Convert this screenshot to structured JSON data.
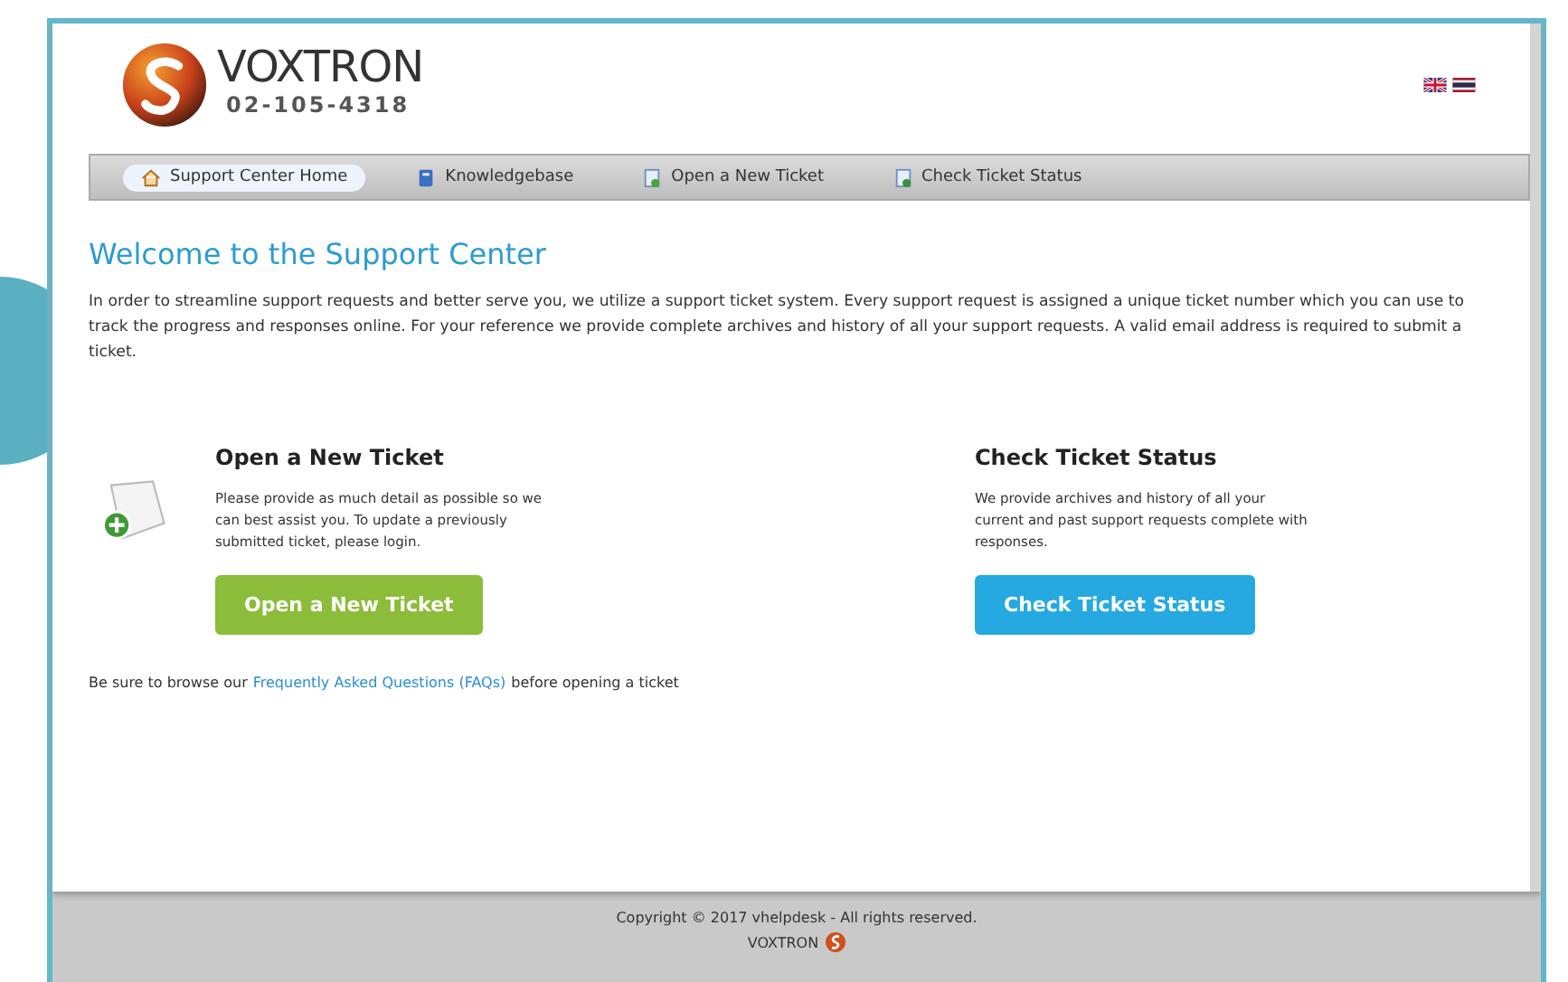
{
  "header": {
    "brand": "VOXTRON",
    "phone": "02-105-4318"
  },
  "nav": [
    {
      "label": "Support Center Home",
      "selected": true,
      "kind": "home"
    },
    {
      "label": "Knowledgebase",
      "selected": false,
      "kind": "book"
    },
    {
      "label": "Open a New Ticket",
      "selected": false,
      "kind": "new"
    },
    {
      "label": "Check Ticket Status",
      "selected": false,
      "kind": "status"
    }
  ],
  "welcome": {
    "title": "Welcome to the Support Center",
    "text": "In order to streamline support requests and better serve you, we utilize a support ticket system. Every support request is assigned a unique ticket number which you can use to track the progress and responses online. For your reference we provide complete archives and history of all your support requests. A valid email address is required to submit a ticket."
  },
  "cards": [
    {
      "title": "Open a New Ticket",
      "text": "Please provide as much detail as possible so we can best assist you. To update a previously submitted ticket, please login.",
      "button": "Open a New Ticket",
      "kind": "green"
    },
    {
      "title": "Check Ticket Status",
      "text": "We provide archives and history of all your current and past support requests complete with responses.",
      "button": "Check Ticket Status",
      "kind": "blue"
    }
  ],
  "faq": {
    "before": "Be sure to browse our",
    "link": "Frequently Asked Questions (FAQs)",
    "after": "before opening a ticket"
  },
  "footer": {
    "copyright": "Copyright © 2017 vhelpdesk - All rights reserved.",
    "brand": "VOXTRON"
  }
}
